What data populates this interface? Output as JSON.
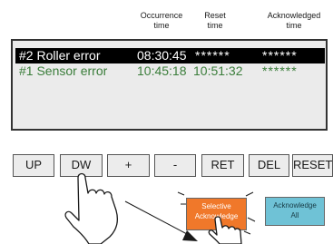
{
  "columns": {
    "occurrence": [
      "Occurrence",
      "time"
    ],
    "reset": [
      "Reset",
      "time"
    ],
    "acknowledged": [
      "Acknowledged",
      "time"
    ]
  },
  "alarms": [
    {
      "name": "#2 Roller error",
      "occurrence": "08:30:45",
      "reset": "******",
      "acknowledged": "******",
      "selected": true
    },
    {
      "name": "#1 Sensor error",
      "occurrence": "10:45:18",
      "reset": "10:51:32",
      "acknowledged": "******",
      "selected": false
    }
  ],
  "buttons": {
    "up": "UP",
    "down": "DW",
    "plus": "+",
    "minus": "-",
    "ret": "RET",
    "del": "DEL",
    "reset": "RESET"
  },
  "actions": {
    "selective": [
      "Selective",
      "Acknowledge"
    ],
    "all": [
      "Acknowledge",
      "All"
    ]
  },
  "colors": {
    "selected_row_bg": "#000000",
    "normal_row_text": "#3a7d3a",
    "selective_button": "#f0782a",
    "acknowledge_all_button": "#6fc2d6"
  },
  "icons": [
    "hand-pointer-icon",
    "hand-pointer-icon"
  ]
}
